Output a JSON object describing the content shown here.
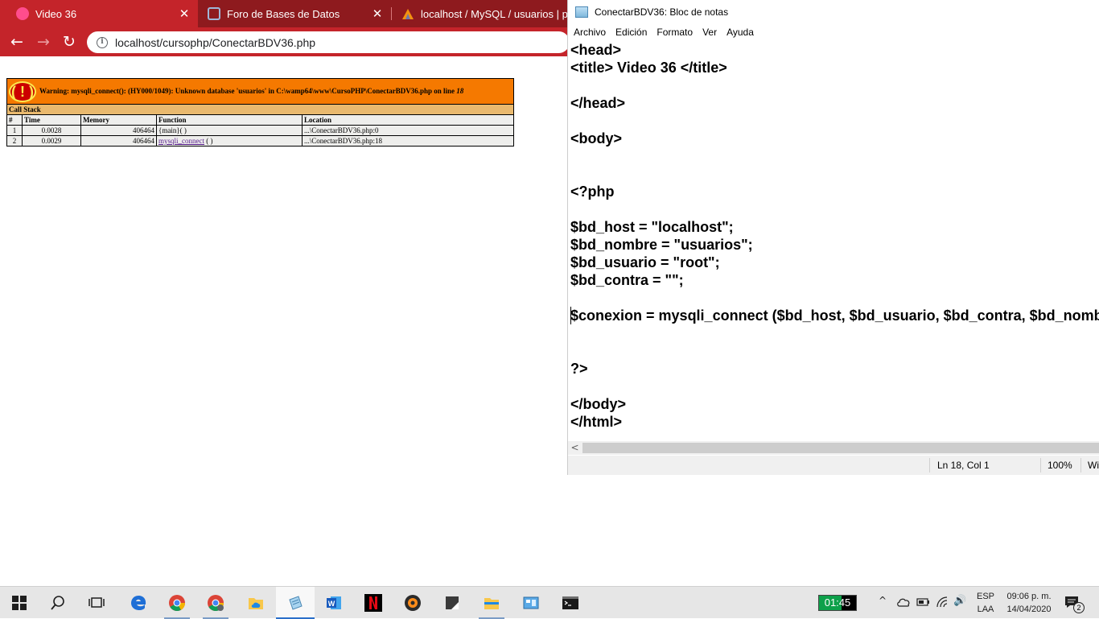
{
  "browser": {
    "tabs": [
      {
        "title": "Video 36",
        "active": true
      },
      {
        "title": "Foro de Bases de Datos",
        "active": false
      },
      {
        "title": "localhost / MySQL / usuarios | ph",
        "active": false
      }
    ],
    "close_glyph": "✕",
    "url": "localhost/cursophp/ConectarBDV36.php",
    "colors": {
      "tabbar": "#8e1a1e",
      "toolbar": "#c4242a"
    }
  },
  "php_warning": {
    "icon_text": "( ! )",
    "message_prefix": "Warning: mysqli_connect(): (HY000/1049): Unknown database 'usuarios' in C:\\wamp64\\www\\CursoPHP\\ConectarBDV36.php on line ",
    "line": "18",
    "call_stack_label": "Call Stack",
    "columns": [
      "#",
      "Time",
      "Memory",
      "Function",
      "Location"
    ],
    "rows": [
      {
        "num": "1",
        "time": "0.0028",
        "memory": "406464",
        "function": "{main}( )",
        "function_link": "",
        "location": "...\\ConectarBDV36.php:0"
      },
      {
        "num": "2",
        "time": "0.0029",
        "memory": "406464",
        "function": "( )",
        "function_link": "mysqli_connect",
        "location": "...\\ConectarBDV36.php:18"
      }
    ],
    "colors": {
      "warning_bg": "#f57900",
      "callstack_bg": "#e9b96e",
      "cell_bg": "#eeeeec"
    }
  },
  "notepad": {
    "title": "ConectarBDV36: Bloc de notas",
    "menu": [
      "Archivo",
      "Edición",
      "Formato",
      "Ver",
      "Ayuda"
    ],
    "code_lines": [
      "<head>",
      "<title> Video 36 </title>",
      "",
      "</head>",
      "",
      "<body>",
      "",
      "",
      "<?php",
      "",
      "$bd_host = \"localhost\";",
      "$bd_nombre = \"usuarios\";",
      "$bd_usuario = \"root\";",
      "$bd_contra = \"\";",
      "",
      "$conexion = mysqli_connect ($bd_host, $bd_usuario, $bd_contra, $bd_nombre);",
      "",
      "",
      "?>",
      "",
      "</body>",
      "</html>"
    ],
    "status": {
      "position": "Ln 18, Col 1",
      "zoom": "100%",
      "encoding": "Wi"
    },
    "scroll_left_glyph": "<"
  },
  "taskbar": {
    "apps": [
      {
        "name": "windows-start",
        "active": false
      },
      {
        "name": "search",
        "active": false
      },
      {
        "name": "task-view",
        "active": false
      },
      {
        "name": "edge",
        "active": false
      },
      {
        "name": "chrome",
        "active": false
      },
      {
        "name": "chrome-profile",
        "active": false
      },
      {
        "name": "onedrive-folder",
        "active": false
      },
      {
        "name": "notepad",
        "active": true
      },
      {
        "name": "word",
        "active": false
      },
      {
        "name": "netflix",
        "active": false
      },
      {
        "name": "music-player",
        "active": false
      },
      {
        "name": "snipping-tool",
        "active": false
      },
      {
        "name": "file-explorer",
        "active": false
      },
      {
        "name": "control-panel",
        "active": false
      },
      {
        "name": "terminal",
        "active": false
      }
    ],
    "timer": "01:45",
    "tray_glyphs": {
      "chevron": "^",
      "volume": "🔊"
    },
    "language": {
      "line1": "ESP",
      "line2": "LAA"
    },
    "time": "09:06 p. m.",
    "date": "14/04/2020",
    "notification_count": "2"
  }
}
